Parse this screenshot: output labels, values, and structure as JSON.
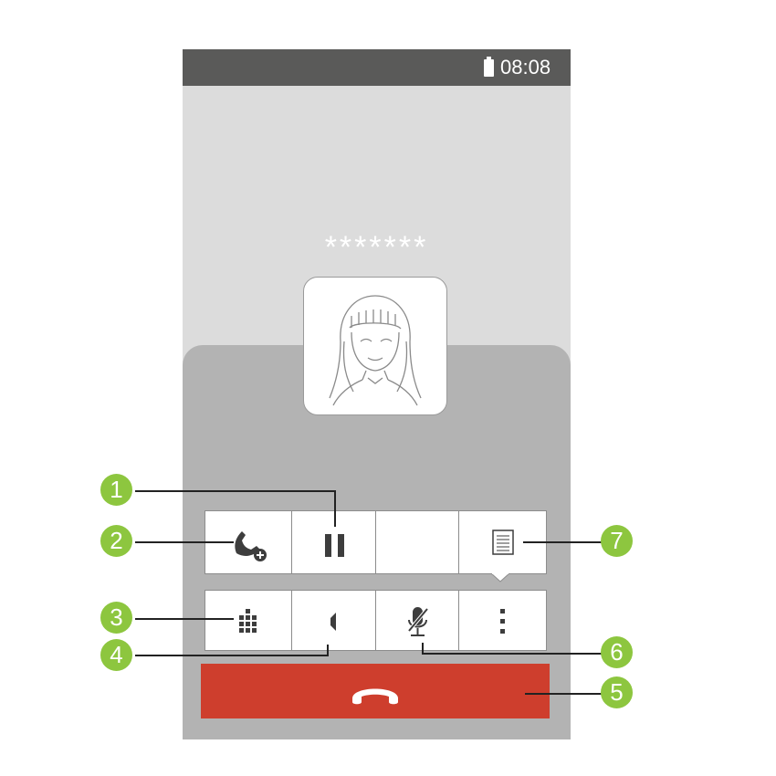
{
  "status_bar": {
    "time": "08:08",
    "battery_icon": "battery-full-icon"
  },
  "caller": {
    "number": "*******",
    "photo_icon": "contact-photo-girl"
  },
  "controls": {
    "row1": [
      "add-call-icon",
      "hold-icon",
      "",
      "notes-icon"
    ],
    "row2": [
      "dialpad-icon",
      "speaker-icon",
      "mute-mic-icon",
      "more-options-icon"
    ]
  },
  "end_call": {
    "icon": "end-call-icon",
    "color": "#ce3e2d"
  },
  "callouts": [
    "1",
    "2",
    "3",
    "4",
    "5",
    "6",
    "7"
  ],
  "colors": {
    "callout": "#8dc63f",
    "status_bar": "#5a5a59",
    "screen_bg": "#dcdcdc",
    "panel_bg": "#b3b3b3"
  }
}
